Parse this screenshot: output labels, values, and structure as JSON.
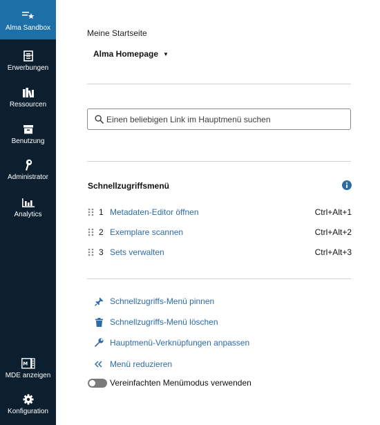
{
  "sidebar": {
    "items": [
      {
        "label": "Alma Sandbox",
        "icon": "sandbox-star-icon"
      },
      {
        "label": "Erwerbungen",
        "icon": "acquisitions-icon"
      },
      {
        "label": "Ressourcen",
        "icon": "books-icon"
      },
      {
        "label": "Benutzung",
        "icon": "inbox-tray-icon"
      },
      {
        "label": "Administrator",
        "icon": "wrench-key-icon"
      },
      {
        "label": "Analytics",
        "icon": "bar-chart-icon"
      },
      {
        "label": "MDE anzeigen",
        "icon": "md-editor-icon"
      },
      {
        "label": "Konfiguration",
        "icon": "gear-icon"
      }
    ],
    "active_color": "#1d6fa8",
    "bg_color": "#0b1f2e"
  },
  "home": {
    "label": "Meine Startseite",
    "selected": "Alma Homepage"
  },
  "search": {
    "placeholder": "Einen beliebigen Link im Hauptmenü suchen",
    "value": ""
  },
  "quick_access": {
    "title": "Schnellzugriffsmenü",
    "items": [
      {
        "num": "1",
        "label": "Metadaten-Editor öffnen",
        "shortcut": "Ctrl+Alt+1"
      },
      {
        "num": "2",
        "label": "Exemplare scannen",
        "shortcut": "Ctrl+Alt+2"
      },
      {
        "num": "3",
        "label": "Sets verwalten",
        "shortcut": "Ctrl+Alt+3"
      }
    ]
  },
  "actions": [
    {
      "label": "Schnellzugriffs-Menü pinnen",
      "icon": "pin-icon"
    },
    {
      "label": "Schnellzugriffs-Menü löschen",
      "icon": "trash-icon"
    },
    {
      "label": "Hauptmenü-Verknüpfungen anpassen",
      "icon": "wrench-icon"
    },
    {
      "label": "Menü reduzieren",
      "icon": "double-chevron-left-icon"
    }
  ],
  "simplified_mode": {
    "label": "Vereinfachten Menümodus verwenden",
    "enabled": false
  },
  "colors": {
    "link": "#2c6ca6",
    "info_icon": "#2c6ca6"
  }
}
